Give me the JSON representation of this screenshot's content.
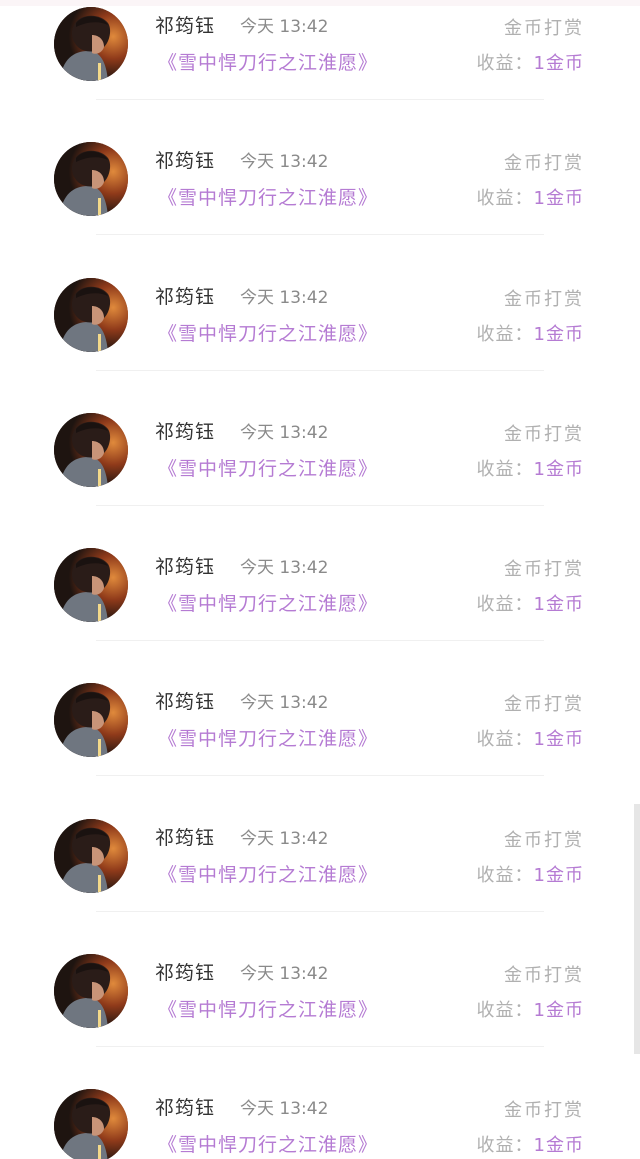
{
  "colors": {
    "name": "#333333",
    "time": "#8a8a8a",
    "accent_purple": "#b57bd3",
    "muted": "#b0b0b0"
  },
  "records": [
    {
      "name": "祁筠钰",
      "time": "今天 13:42",
      "book": "《雪中悍刀行之江淮愿》",
      "action": "金币打赏",
      "income_label": "收益：",
      "income_amount": "1金币",
      "avatar_icon": "user-avatar"
    },
    {
      "name": "祁筠钰",
      "time": "今天 13:42",
      "book": "《雪中悍刀行之江淮愿》",
      "action": "金币打赏",
      "income_label": "收益：",
      "income_amount": "1金币",
      "avatar_icon": "user-avatar"
    },
    {
      "name": "祁筠钰",
      "time": "今天 13:42",
      "book": "《雪中悍刀行之江淮愿》",
      "action": "金币打赏",
      "income_label": "收益：",
      "income_amount": "1金币",
      "avatar_icon": "user-avatar"
    },
    {
      "name": "祁筠钰",
      "time": "今天 13:42",
      "book": "《雪中悍刀行之江淮愿》",
      "action": "金币打赏",
      "income_label": "收益：",
      "income_amount": "1金币",
      "avatar_icon": "user-avatar"
    },
    {
      "name": "祁筠钰",
      "time": "今天 13:42",
      "book": "《雪中悍刀行之江淮愿》",
      "action": "金币打赏",
      "income_label": "收益：",
      "income_amount": "1金币",
      "avatar_icon": "user-avatar"
    },
    {
      "name": "祁筠钰",
      "time": "今天 13:42",
      "book": "《雪中悍刀行之江淮愿》",
      "action": "金币打赏",
      "income_label": "收益：",
      "income_amount": "1金币",
      "avatar_icon": "user-avatar"
    },
    {
      "name": "祁筠钰",
      "time": "今天 13:42",
      "book": "《雪中悍刀行之江淮愿》",
      "action": "金币打赏",
      "income_label": "收益：",
      "income_amount": "1金币",
      "avatar_icon": "user-avatar"
    },
    {
      "name": "祁筠钰",
      "time": "今天 13:42",
      "book": "《雪中悍刀行之江淮愿》",
      "action": "金币打赏",
      "income_label": "收益：",
      "income_amount": "1金币",
      "avatar_icon": "user-avatar"
    },
    {
      "name": "祁筠钰",
      "time": "今天 13:42",
      "book": "《雪中悍刀行之江淮愿》",
      "action": "金币打赏",
      "income_label": "收益：",
      "income_amount": "1金币",
      "avatar_icon": "user-avatar"
    }
  ]
}
